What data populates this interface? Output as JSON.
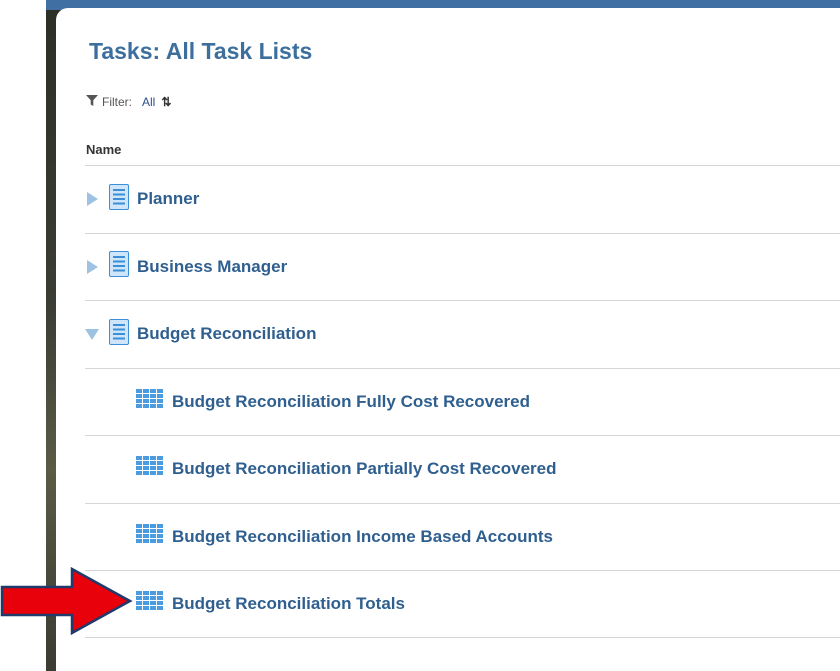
{
  "page": {
    "title": "Tasks: All Task Lists"
  },
  "filter": {
    "label": "Filter:",
    "value": "All",
    "filter_icon": "filter-icon",
    "sort_icon": "sort-toggle-icon"
  },
  "table": {
    "column_header": "Name",
    "rows": [
      {
        "label": "Planner",
        "type": "task-list",
        "expanded": false
      },
      {
        "label": "Business Manager",
        "type": "task-list",
        "expanded": false
      },
      {
        "label": "Budget Reconciliation",
        "type": "task-list",
        "expanded": true
      },
      {
        "label": "Budget Reconciliation Fully Cost Recovered",
        "type": "task"
      },
      {
        "label": "Budget Reconciliation Partially Cost Recovered",
        "type": "task"
      },
      {
        "label": "Budget Reconciliation Income Based Accounts",
        "type": "task"
      },
      {
        "label": "Budget Reconciliation Totals",
        "type": "task"
      }
    ]
  },
  "annotation": {
    "arrow_icon": "red-arrow-icon",
    "arrow_color": "#e8000b"
  },
  "colors": {
    "title": "#3d6f9e",
    "row_text": "#2f5f8f",
    "icon_blue": "#3a8fd6",
    "divider": "#d6d6d6"
  }
}
